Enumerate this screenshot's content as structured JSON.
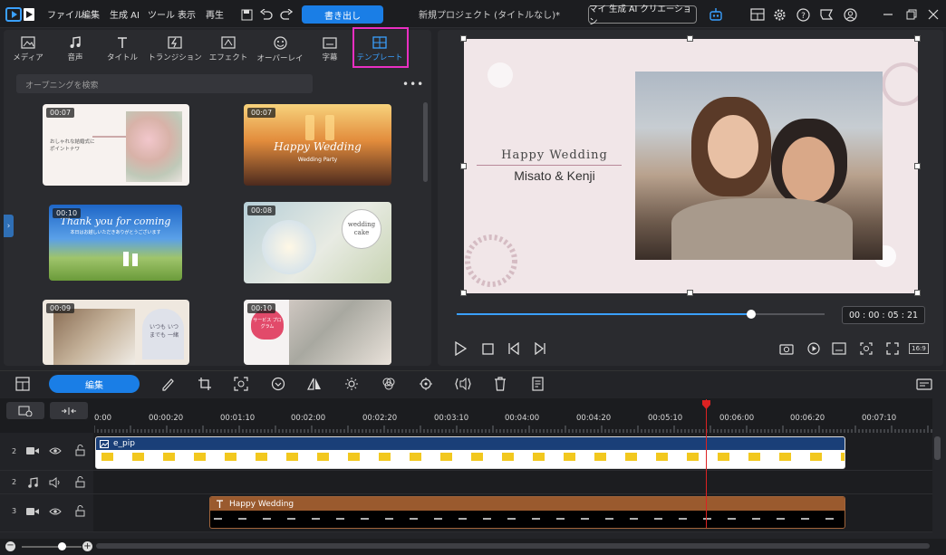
{
  "menu": [
    "ファイル",
    "編集",
    "生成 AI",
    "ツール",
    "表示",
    "再生"
  ],
  "export_label": "書き出し",
  "project_title": "新規プロジェクト (タイトルなし)*",
  "ai_creation_label": "マイ 生成 AI クリエーション",
  "tabs": [
    {
      "label": "メディア",
      "icon": "media-icon"
    },
    {
      "label": "音声",
      "icon": "music-note-icon"
    },
    {
      "label": "タイトル",
      "icon": "title-t-icon"
    },
    {
      "label": "トランジション",
      "icon": "transition-icon"
    },
    {
      "label": "エフェクト",
      "icon": "effect-icon"
    },
    {
      "label": "オーバーレイ",
      "icon": "overlay-icon"
    },
    {
      "label": "字幕",
      "icon": "subtitle-icon"
    },
    {
      "label": "テンプレート",
      "icon": "template-icon"
    }
  ],
  "search_placeholder": "オープニングを検索",
  "templates": [
    {
      "duration": "00:07",
      "text": "おしゃれな結婚式に ポイントナワ"
    },
    {
      "duration": "00:07",
      "text": "Happy Wedding",
      "sub": "Wedding Party"
    },
    {
      "duration": "00:10",
      "text": "Thank you for coming",
      "sub": "本日はお越しいただきありがとうございます"
    },
    {
      "duration": "00:08",
      "text": "wedding cake"
    },
    {
      "duration": "00:09",
      "text": "いつも いつまでも 一緒"
    },
    {
      "duration": "00:10",
      "text": "サービス プログラム"
    }
  ],
  "preview": {
    "title": "Happy Wedding",
    "names": "Misato & Kenji",
    "timecode": "00 : 00 : 05 : 21",
    "progress": 0.8,
    "aspect": "16:9"
  },
  "timeline": {
    "edit_label": "編集",
    "ruler": [
      "0:00",
      "00:00:20",
      "00:01:10",
      "00:02:00",
      "00:02:20",
      "00:03:10",
      "00:04:00",
      "00:04:20",
      "00:05:10",
      "00:06:00",
      "00:06:20",
      "00:07:10"
    ],
    "tracks": [
      {
        "num": "2",
        "type": "video",
        "clip": "e_pip"
      },
      {
        "num": "2",
        "type": "audio",
        "clip": ""
      },
      {
        "num": "3",
        "type": "video",
        "clip": "Happy Wedding"
      }
    ]
  },
  "colors": {
    "accent": "#1a7ee6",
    "highlight": "#e92fc2",
    "playhead": "#d22222",
    "title_clip": "#9a5a2e",
    "pip_clip": "#1a3f78"
  }
}
